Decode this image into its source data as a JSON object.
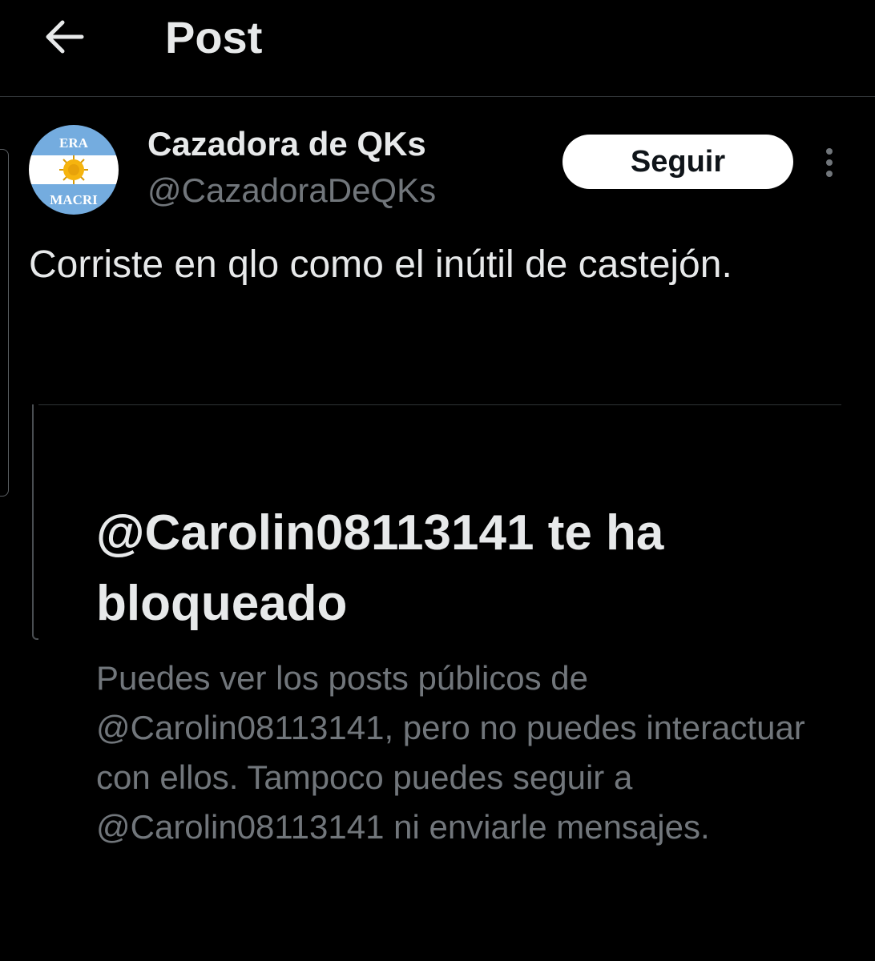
{
  "header": {
    "title": "Post",
    "back_icon": "arrow-left-icon"
  },
  "post": {
    "author": {
      "name": "Cazadora de QKs",
      "handle": "@CazadoraDeQKs",
      "avatar": {
        "text_top": "ERA",
        "text_bottom": "MACRI"
      }
    },
    "follow_label": "Seguir",
    "more_icon": "more-vertical-icon",
    "text": "Corriste en qlo como el inútil de castejón."
  },
  "blocked_notice": {
    "title": "@Carolin08113141 te ha bloqueado",
    "description": "Puedes ver los posts públicos de @Carolin08113141, pero no puedes interactuar con ellos. Tampoco puedes seguir a @Carolin08113141 ni enviarle mensajes."
  },
  "colors": {
    "background": "#000000",
    "text_primary": "#e7e9ea",
    "text_secondary": "#71767b",
    "divider": "#2f3336",
    "follow_button_bg": "#ffffff",
    "flag_blue": "#74acdf",
    "sun_yellow": "#f6b40e"
  }
}
